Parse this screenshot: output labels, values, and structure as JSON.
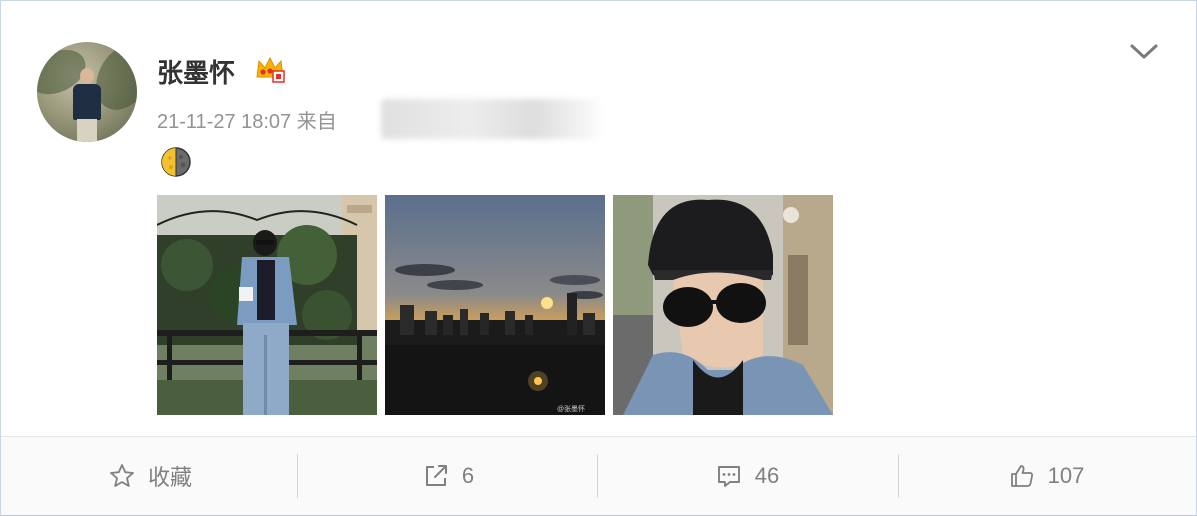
{
  "post": {
    "username": "张墨怀",
    "timestamp": "21-11-27 18:07",
    "source_prefix": "来自",
    "content_emoji": "moon-emoji",
    "images": [
      {
        "name": "photo-1"
      },
      {
        "name": "photo-2",
        "watermark": "@张墨怀"
      },
      {
        "name": "photo-3"
      }
    ]
  },
  "actions": {
    "favorite_label": "收藏",
    "repost_count": "6",
    "comment_count": "46",
    "like_count": "107"
  },
  "icons": {
    "badge": "crown-badge-icon",
    "menu": "chevron-down-icon",
    "favorite": "star-icon",
    "repost": "share-icon",
    "comment": "comment-icon",
    "like": "thumbs-up-icon"
  },
  "colors": {
    "text_primary": "#333333",
    "text_muted": "#939393",
    "action_text": "#808080",
    "badge_orange": "#f5a623"
  }
}
